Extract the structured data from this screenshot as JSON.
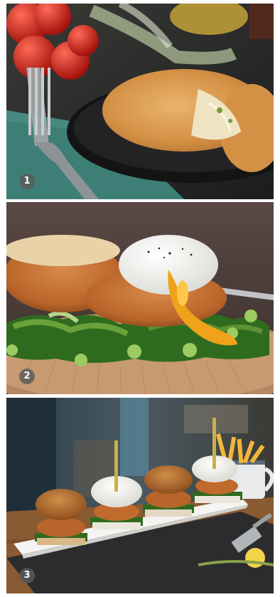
{
  "panels": [
    {
      "number": "1",
      "subject": "fish-cake-with-fork-and-tomatoes"
    },
    {
      "number": "2",
      "subject": "fish-cakes-with-poached-egg-greens-and-peas"
    },
    {
      "number": "3",
      "subject": "sliders-platter-with-fries-in-mug"
    }
  ],
  "colors": {
    "badge": "#5a5a5a",
    "crumb": "#c9833f",
    "yolk": "#f0a21a",
    "greens": "#2f6b1f",
    "tablecloth": "#3d7f76"
  }
}
